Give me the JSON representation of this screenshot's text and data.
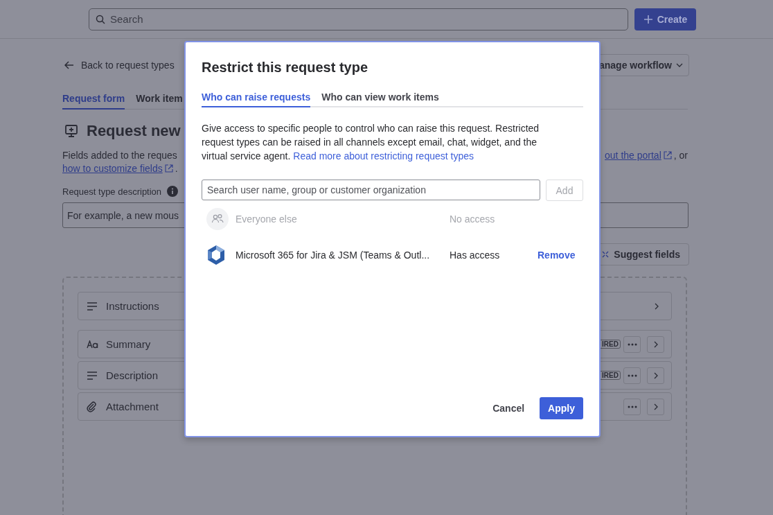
{
  "top_bar": {
    "search": {
      "placeholder": "Search"
    },
    "create_button": "Create"
  },
  "page": {
    "back_link": "Back to request types",
    "manage_button": "anage workflow",
    "tabs": [
      {
        "label": "Request form",
        "selected": true
      },
      {
        "label": "Work item",
        "selected": false
      }
    ],
    "title": "Request new",
    "intro": {
      "line1_text": "Fields added to the reques",
      "line1_link": "out the portal",
      "line1_suffix": ", or",
      "line2_link": "how to customize fields",
      "line2_suffix": "."
    },
    "description_label": "Request type description",
    "description_field": {
      "placeholder": "For example, a new mous"
    },
    "suggest_button": "Suggest fields",
    "fields": [
      {
        "label": "Instructions",
        "kind": "instructions",
        "more": false
      },
      {
        "label": "Summary",
        "kind": "short_text",
        "badge": "IRED",
        "more": true
      },
      {
        "label": "Description",
        "kind": "paragraph",
        "badge": "IRED",
        "more": true
      },
      {
        "label": "Attachment",
        "kind": "attachment",
        "more": true
      }
    ]
  },
  "modal": {
    "title": "Restrict this request type",
    "tabs": [
      {
        "label": "Who can raise requests",
        "selected": true
      },
      {
        "label": "Who can view work items",
        "selected": false
      }
    ],
    "text": "Give access to specific people to control who can raise this request. Restricted request types can be raised in all channels except email, chat, widget, and the virtual service agent.",
    "link": "Read more about restricting request types",
    "search": {
      "placeholder": "Search user name, group or customer organization"
    },
    "add_button": {
      "label": "Add",
      "disabled": true
    },
    "access_list": [
      {
        "name": "Everyone else",
        "access": "No access",
        "kind": "group",
        "disabled": true
      },
      {
        "name": "Microsoft 365 for Jira & JSM (Teams & Outl...",
        "access": "Has access",
        "kind": "app",
        "disabled": false,
        "action": "Remove"
      }
    ],
    "buttons": [
      {
        "label": "Cancel",
        "kind": "subtle"
      },
      {
        "label": "Apply",
        "kind": "primary"
      }
    ]
  }
}
